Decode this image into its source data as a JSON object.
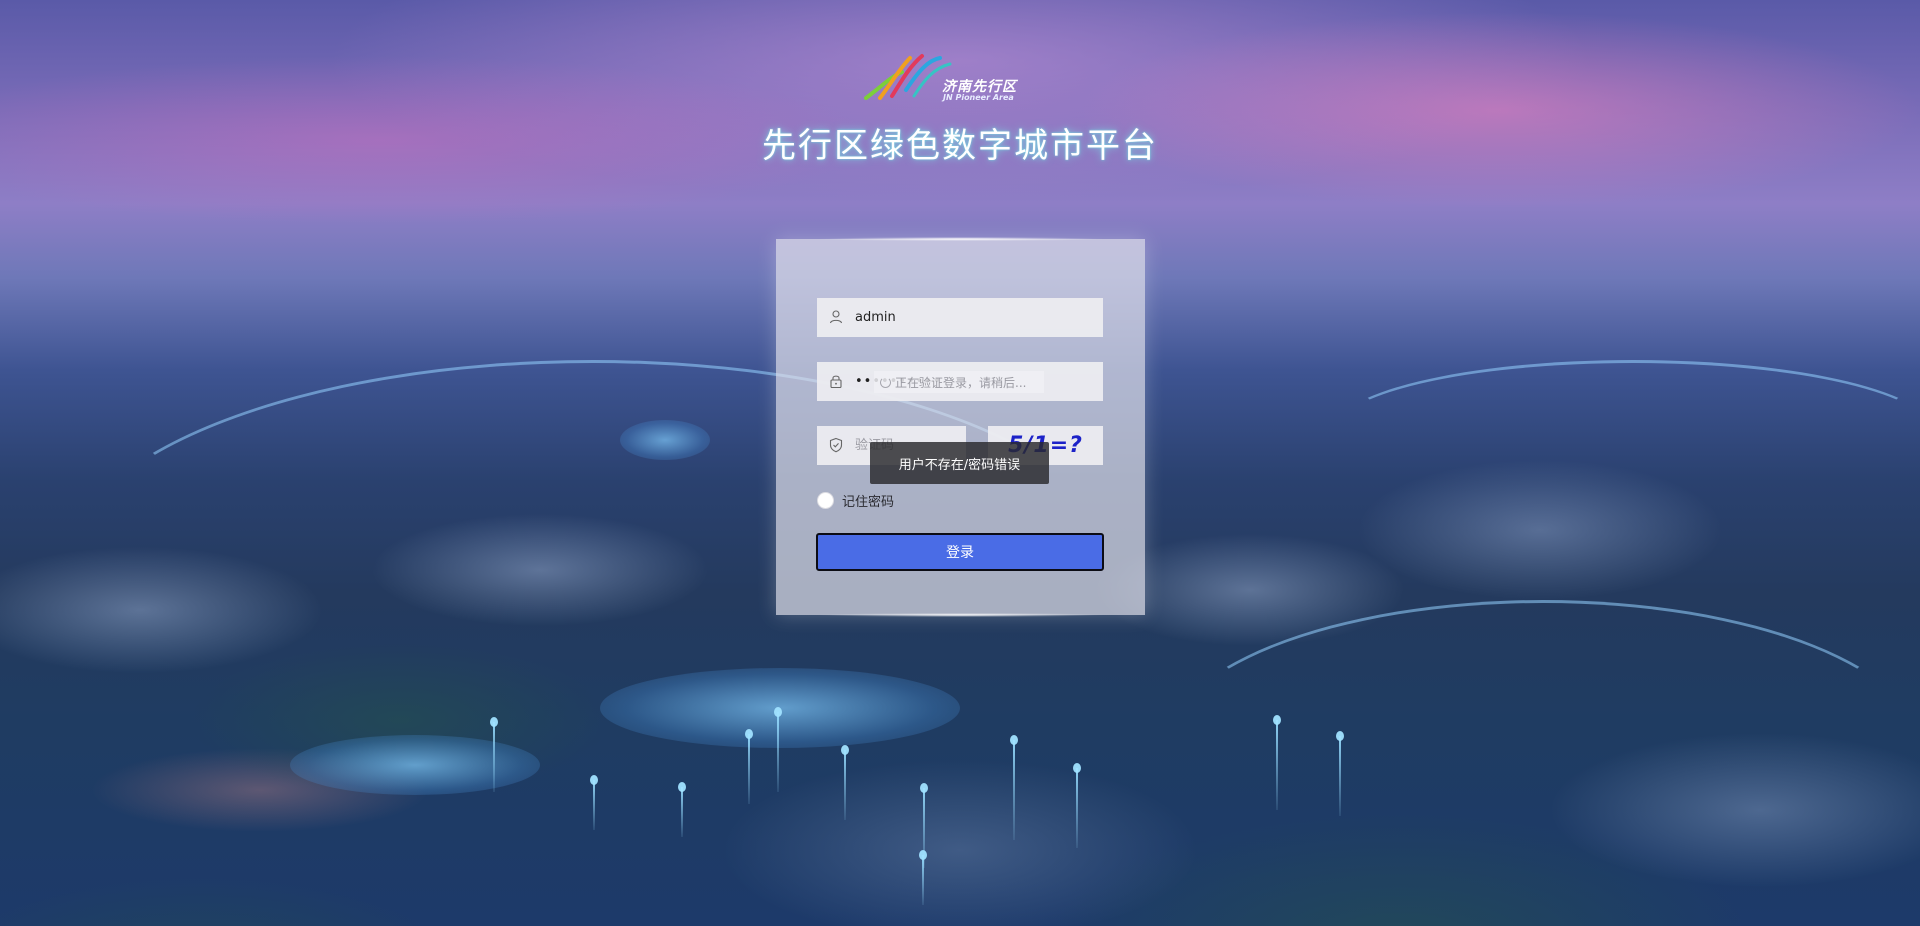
{
  "header": {
    "logo_cn": "济南先行区",
    "logo_en": "JN Pioneer Area",
    "title": "先行区绿色数字城市平台"
  },
  "login": {
    "username_value": "admin",
    "password_value": "••••••••••",
    "code_placeholder": "验证码",
    "captcha_text": "5/1=?",
    "loading_hint": "正在验证登录，请稍后...",
    "error_message": "用户不存在/密码错误",
    "remember_label": "记住密码",
    "remember_checked": false,
    "submit_label": "登录"
  },
  "colors": {
    "button": "#4a6ce6",
    "captcha": "#1c22c8",
    "title_glow": "#78dce6"
  },
  "icons": {
    "username": "user-icon",
    "password": "lock-icon",
    "code": "shield-icon"
  }
}
